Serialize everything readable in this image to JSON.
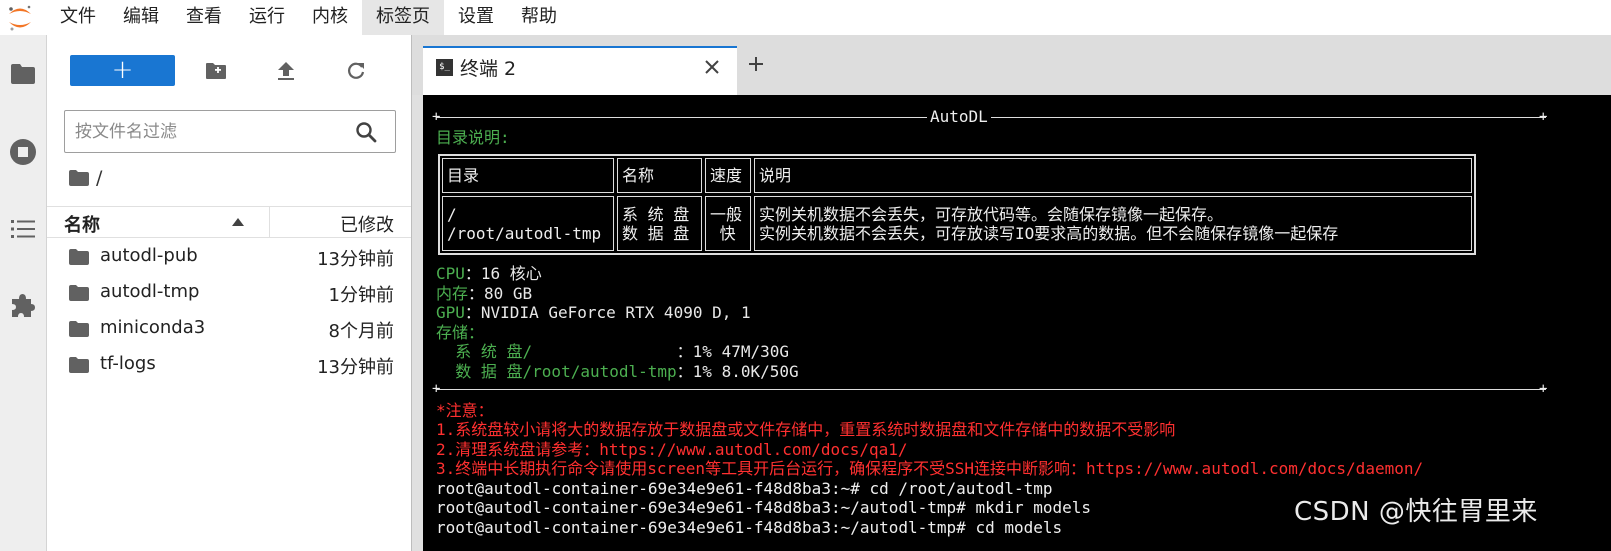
{
  "menu": [
    "文件",
    "编辑",
    "查看",
    "运行",
    "内核",
    "标签页",
    "设置",
    "帮助"
  ],
  "filebrowser": {
    "new_label": "+",
    "filter_placeholder": "按文件名过滤",
    "breadcrumb": "/",
    "col_name": "名称",
    "col_modified": "已修改",
    "files": [
      {
        "name": "autodl-pub",
        "modified": "13分钟前"
      },
      {
        "name": "autodl-tmp",
        "modified": "1分钟前"
      },
      {
        "name": "miniconda3",
        "modified": "8个月前"
      },
      {
        "name": "tf-logs",
        "modified": "13分钟前"
      }
    ]
  },
  "tab": {
    "icon_text": "$_",
    "label": "终端 2",
    "add_label": "+"
  },
  "terminal": {
    "banner": "AutoDL",
    "dir_heading": "目录说明:",
    "table": {
      "headers": [
        "目录",
        "名称",
        "速度",
        "说明"
      ],
      "row1_dirs": "/\n/root/autodl-tmp",
      "row1_names": "系 统 盘\n数 据 盘",
      "row1_speed": "一般\n 快",
      "row1_desc": "实例关机数据不会丢失，可存放代码等。会随保存镜像一起保存。\n实例关机数据不会丢失，可存放读写IO要求高的数据。但不会随保存镜像一起保存"
    },
    "cpu_label": "CPU",
    "cpu_value": "：16 核心",
    "mem_label": "内存",
    "mem_value": "：80 GB",
    "gpu_label": "GPU",
    "gpu_value": "：NVIDIA GeForce RTX 4090 D, 1",
    "storage_label": "存储：",
    "sys_disk_label": "  系 统 盘/               ",
    "sys_disk_value": "：1% 47M/30G",
    "data_disk_label": "  数 据 盘/root/autodl-tmp",
    "data_disk_value": "：1% 8.0K/50G",
    "notice_title": "*注意：",
    "notice_1": "1.系统盘较小请将大的数据存放于数据盘或文件存储中，重置系统时数据盘和文件存储中的数据不受影响",
    "notice_2": "2.清理系统盘请参考：https://www.autodl.com/docs/qa1/",
    "notice_3": "3.终端中长期执行命令请使用screen等工具开后台运行，确保程序不受SSH连接中断影响：https://www.autodl.com/docs/daemon/",
    "cmd_1": "root@autodl-container-69e34e9e61-f48d8ba3:~# cd /root/autodl-tmp",
    "cmd_2": "root@autodl-container-69e34e9e61-f48d8ba3:~/autodl-tmp# mkdir models",
    "cmd_3": "root@autodl-container-69e34e9e61-f48d8ba3:~/autodl-tmp# cd models"
  },
  "watermark": "CSDN @快往胃里来",
  "colors": {
    "accent": "#1976d2",
    "terminal_green": "#4caf50",
    "terminal_red": "#ff3030",
    "logo_orange": "#f37626"
  }
}
